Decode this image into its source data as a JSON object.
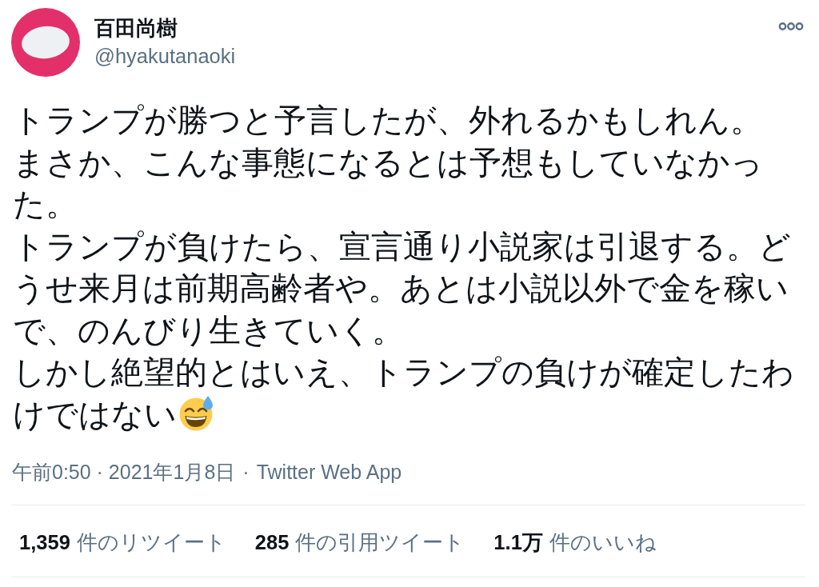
{
  "author": {
    "name": "百田尚樹",
    "handle": "@hyakutanaoki"
  },
  "tweet": {
    "lines": [
      "トランプが勝つと予言したが、外れるかもしれん。",
      "まさか、こんな事態になるとは予想もしていなかっ",
      "た。",
      "トランプが負けたら、宣言通り小説家は引退する。ど",
      "うせ来月は前期高齢者や。あとは小説以外で金を稼い",
      "で、のんびり生きていく。",
      "しかし絶望的とはいえ、トランプの負けが確定したわ",
      "けではない"
    ]
  },
  "meta": {
    "timestamp": "午前0:50 · 2021年1月8日",
    "separator": "·",
    "source": "Twitter Web App"
  },
  "stats": [
    {
      "count": "1,359",
      "label": "件のリツイート"
    },
    {
      "count": "285",
      "label": "件の引用ツイート"
    },
    {
      "count": "1.1万",
      "label": "件のいいね"
    }
  ]
}
